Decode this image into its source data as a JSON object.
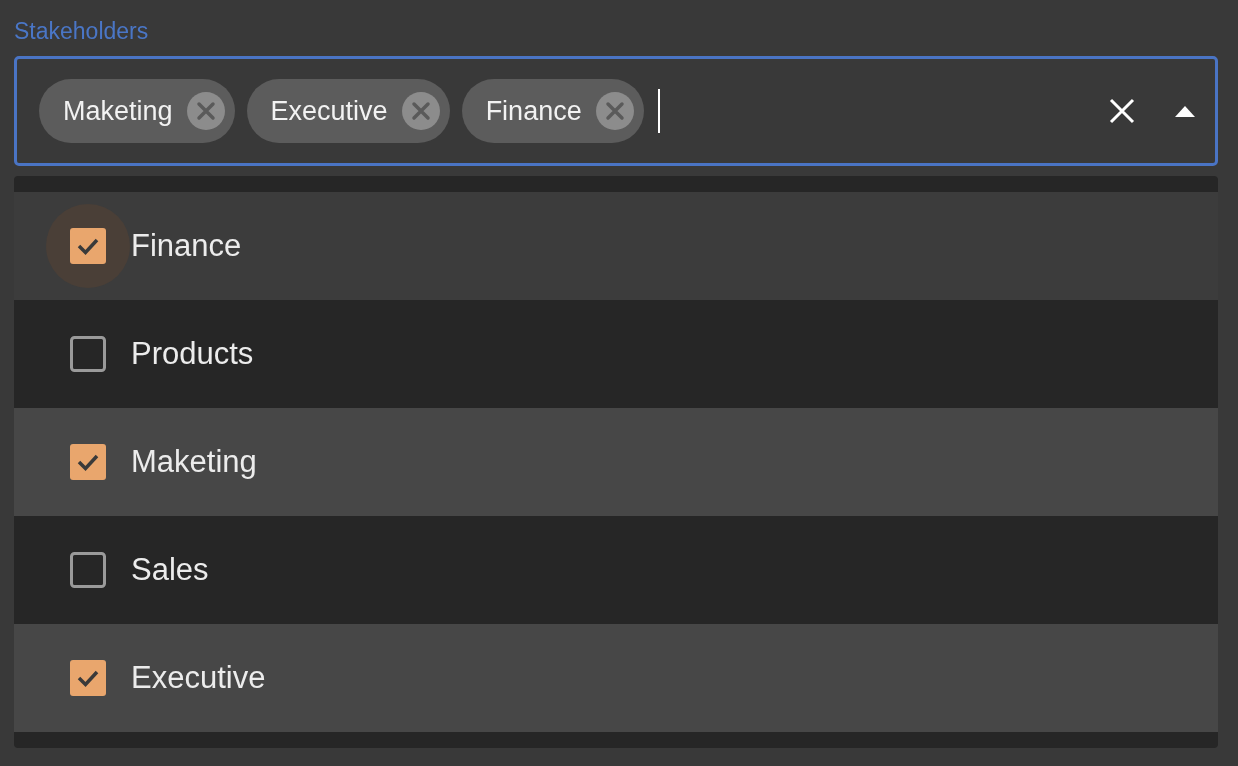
{
  "field": {
    "label": "Stakeholders",
    "focused": true,
    "chips": [
      {
        "label": "Maketing"
      },
      {
        "label": "Executive"
      },
      {
        "label": "Finance"
      }
    ],
    "open": true
  },
  "options": [
    {
      "label": "Finance",
      "checked": true,
      "focused": true
    },
    {
      "label": "Products",
      "checked": false,
      "focused": false
    },
    {
      "label": "Maketing",
      "checked": true,
      "focused": false
    },
    {
      "label": "Sales",
      "checked": false,
      "focused": false
    },
    {
      "label": "Executive",
      "checked": true,
      "focused": false
    }
  ]
}
